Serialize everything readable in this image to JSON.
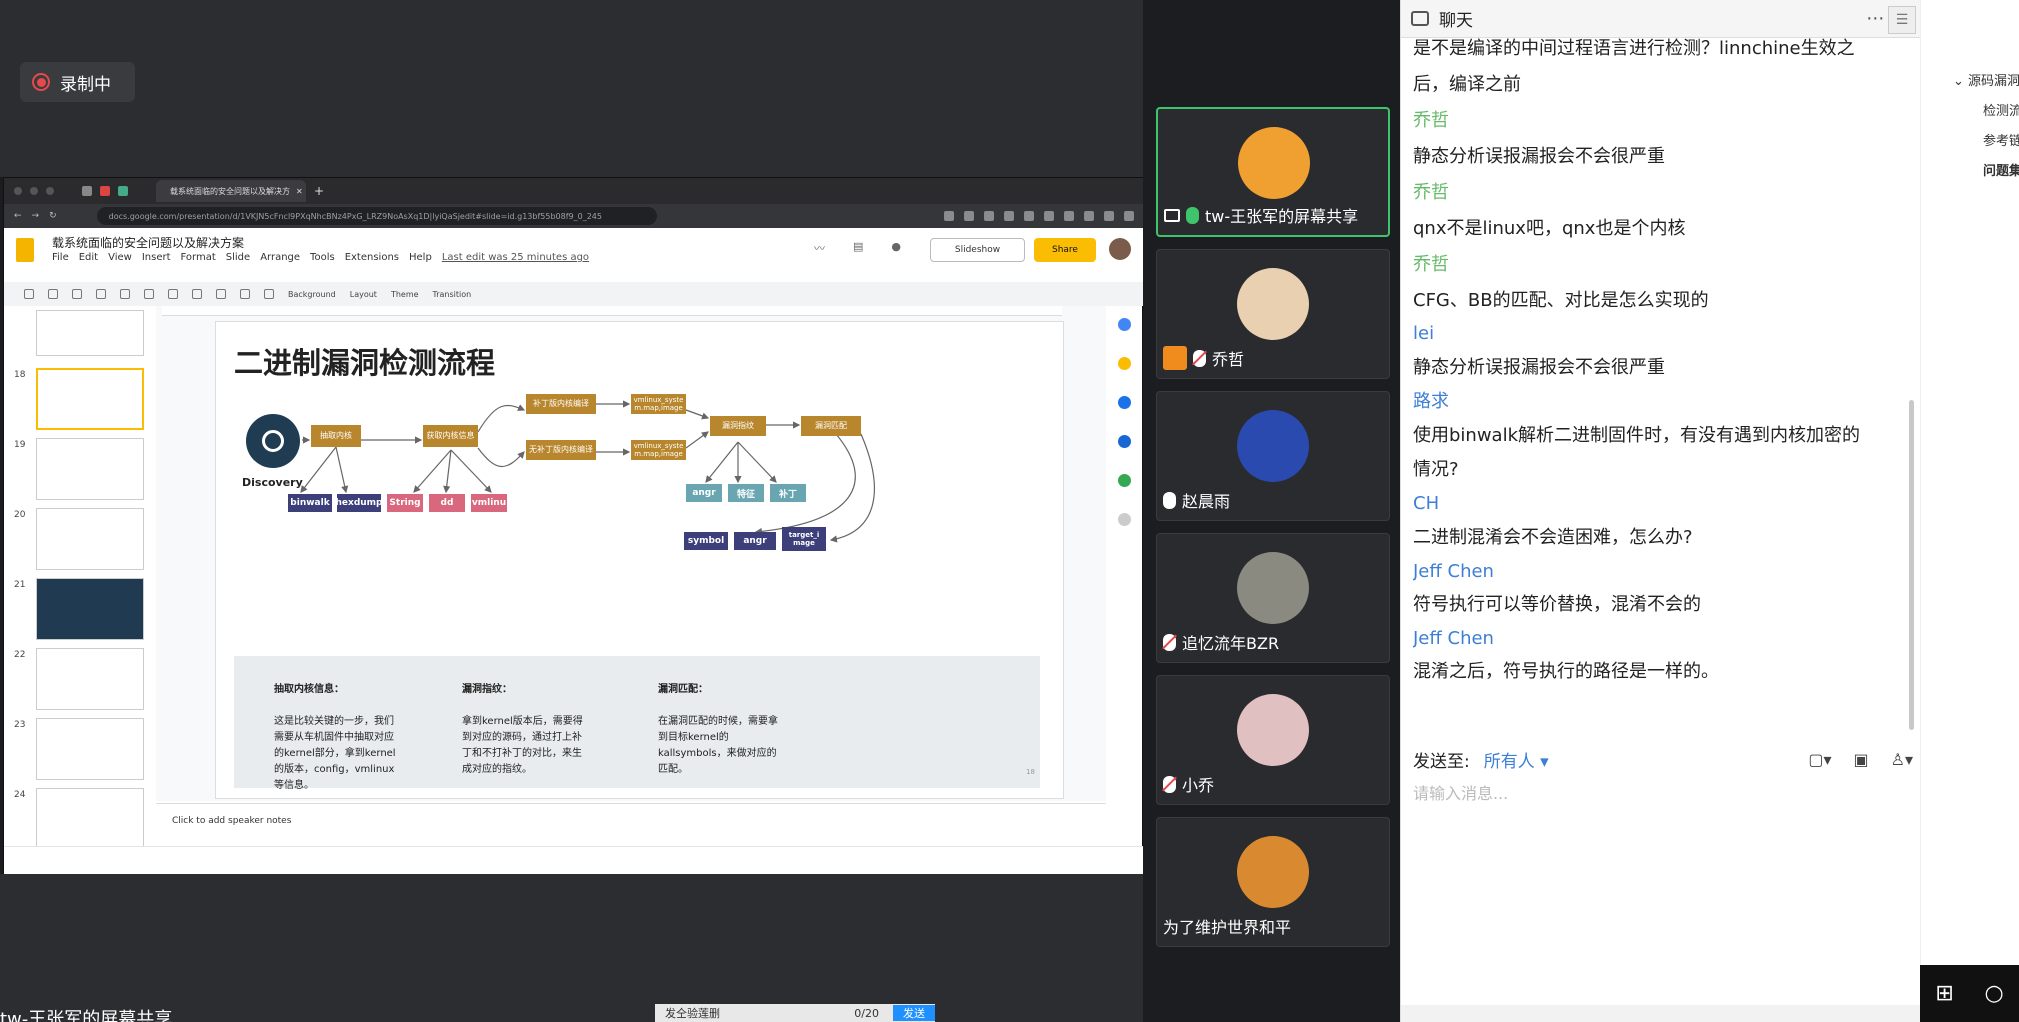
{
  "recording": {
    "label": "录制中"
  },
  "browser": {
    "tab_title": "载系统面临的安全问题以及解决方",
    "url": "docs.google.com/presentation/d/1VKJN5cFncl9PXqNhcBNz4PxG_LRZ9NoAsXq1D|lyiQaSjedit#slide=id.g13bf55b08f9_0_245"
  },
  "slides_app": {
    "doc_title": "载系统面临的安全问题以及解决方案",
    "menu": [
      "File",
      "Edit",
      "View",
      "Insert",
      "Format",
      "Slide",
      "Arrange",
      "Tools",
      "Extensions",
      "Help"
    ],
    "last_edit": "Last edit was 25 minutes ago",
    "slideshow_label": "Slideshow",
    "share_label": "Share",
    "toolbar": [
      "Background",
      "Layout",
      "Theme",
      "Transition"
    ],
    "thumb_numbers": [
      "18",
      "19",
      "20",
      "21",
      "22",
      "23",
      "24"
    ],
    "speaker_notes": "Click to add speaker notes"
  },
  "slide": {
    "title": "二进制漏洞检测流程",
    "discovery_label": "Discovery",
    "nodes": {
      "extract_kernel": "抽取内核",
      "get_kernel_info": "获取内核信息",
      "patched_compile": "补丁版内核编译",
      "unpatched_compile": "无补丁版内核编译",
      "vmlinux_a": "vmlinux_syste m.map,image",
      "vmlinux_b": "vmlinux_syste m.map,image",
      "vuln_fingerprint": "漏洞指纹",
      "vuln_match": "漏洞匹配"
    },
    "tags": {
      "binwalk": "binwalk",
      "hexdump": "hexdump",
      "string": "String",
      "dd": "dd",
      "vmlinu": "vmlinu",
      "angr1": "angr",
      "feature": "特征",
      "patch": "补丁",
      "symbol": "symbol",
      "angr2": "angr",
      "target_image": "target_i mage"
    },
    "info": [
      {
        "title": "抽取内核信息：",
        "body": "这是比较关键的一步，我们\n需要从车机固件中抽取对应\n的kernel部分，拿到kernel\n的版本，config，vmlinux\n等信息。"
      },
      {
        "title": "漏洞指纹：",
        "body": "拿到kernel版本后，需要得\n到对应的源码，通过打上补\n丁和不打补丁的对比，来生\n成对应的指纹。"
      },
      {
        "title": "漏洞匹配：",
        "body": "在漏洞匹配的时候，需要拿\n到目标kernel的\nkallsymbols，来做对应的\n匹配。"
      }
    ],
    "page_number": "18"
  },
  "participants": [
    {
      "name": "tw-王张军的屏幕共享",
      "status": "sharing"
    },
    {
      "name": "乔哲",
      "status": "host-muted"
    },
    {
      "name": "赵晨雨",
      "status": "mic"
    },
    {
      "name": "追忆流年BZR",
      "status": "muted"
    },
    {
      "name": "小乔",
      "status": "muted"
    },
    {
      "name": "为了维护世界和平",
      "status": "none"
    }
  ],
  "chat": {
    "title": "聊天",
    "messages": [
      {
        "type": "text",
        "text": "是不是编译的中间过程语言进行检测？linnchine生效之"
      },
      {
        "type": "text",
        "text": "后，编译之前"
      },
      {
        "type": "name-green",
        "text": "乔哲"
      },
      {
        "type": "text",
        "text": "静态分析误报漏报会不会很严重"
      },
      {
        "type": "name-green",
        "text": "乔哲"
      },
      {
        "type": "text",
        "text": " qnx不是linux吧，qnx也是个内核"
      },
      {
        "type": "name-green",
        "text": "乔哲"
      },
      {
        "type": "text",
        "text": "CFG、BB的匹配、对比是怎么实现的"
      },
      {
        "type": "name-blue",
        "text": "lei"
      },
      {
        "type": "text",
        "text": "静态分析误报漏报会不会很严重"
      },
      {
        "type": "name-blue",
        "text": "路求"
      },
      {
        "type": "text",
        "text": "使用binwalk解析二进制固件时，有没有遇到内核加密的"
      },
      {
        "type": "text",
        "text": "情况?"
      },
      {
        "type": "name-blue",
        "text": "CH"
      },
      {
        "type": "text",
        "text": "二进制混淆会不会造困难，怎么办?"
      },
      {
        "type": "name-blue",
        "text": "Jeff Chen"
      },
      {
        "type": "text",
        "text": "符号执行可以等价替换，混淆不会的"
      },
      {
        "type": "name-blue",
        "text": "Jeff Chen"
      },
      {
        "type": "text",
        "text": "混淆之后，符号执行的路径是一样的。"
      }
    ],
    "send_to_label": "发送至:",
    "send_target": "所有人",
    "input_placeholder": "请输入消息..."
  },
  "right_pane": {
    "items": [
      "源码漏洞",
      "检测流",
      "参考链",
      "问题集"
    ]
  },
  "bottom": {
    "text": "tw-王张军的屏幕共享",
    "overlay_text": "发仝验莲删",
    "overlay_count": "0/20",
    "overlay_send": "发送"
  }
}
